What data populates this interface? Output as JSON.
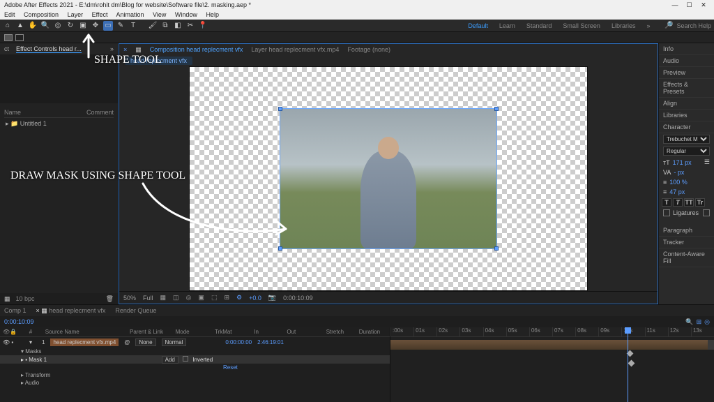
{
  "title": "Adobe After Effects 2021 - E:\\dm\\rohit dm\\Blog for website\\Software file\\2. masking.aep *",
  "menu": [
    "Edit",
    "Composition",
    "Layer",
    "Effect",
    "Animation",
    "View",
    "Window",
    "Help"
  ],
  "workspaces": {
    "active": "Default",
    "items": [
      "Default",
      "Learn",
      "Standard",
      "Small Screen",
      "Libraries"
    ]
  },
  "search_placeholder": "Search Help",
  "subbar": {
    "tool": "",
    "ec_label": "Effect Controls head r..."
  },
  "project": {
    "tabs": [
      "ct",
      "Effect Controls head r..."
    ],
    "cols": [
      "Name",
      "Comment"
    ],
    "items": [
      "Untitled 1"
    ]
  },
  "comp": {
    "tabs": [
      {
        "label": "Composition head replecment vfx",
        "active": true
      },
      {
        "label": "Layer head replecment vfx.mp4",
        "active": false
      },
      {
        "label": "Footage (none)",
        "active": false
      }
    ],
    "chip": "head replecment vfx"
  },
  "viewer_footer": {
    "zoom": "50%",
    "res": "Full",
    "fx": "+0.0",
    "cam": "",
    "time": "0:00:10:09"
  },
  "right_panels": [
    "Info",
    "Audio",
    "Preview",
    "Effects & Presets",
    "Align",
    "Libraries"
  ],
  "character": {
    "label": "Character",
    "font": "Trebuchet MS",
    "style": "Regular",
    "size": "171 px",
    "leading": "",
    "kerning": "- px",
    "tracking": "",
    "vscale": "100 %",
    "hscale": "47 px",
    "buttons": [
      "T",
      "T",
      "TT",
      "Tr"
    ],
    "ligatures": "Ligatures"
  },
  "right_lower": [
    "Paragraph",
    "Tracker",
    "Content-Aware Fill"
  ],
  "timeline": {
    "tabs": [
      "Comp 1",
      "head replecment vfx",
      "Render Queue"
    ],
    "active": "head replecment vfx",
    "timecode": "0:00:10:09",
    "cols": [
      "",
      "#",
      "Source Name",
      "Parent & Link",
      "Mode",
      "TrkMat",
      "",
      "In",
      "Out",
      "Stretch",
      "Duration"
    ],
    "layer": {
      "num": "1",
      "name": "head replecment vfx.mp4",
      "parent": "None",
      "mode": "Normal",
      "in": "0:00:00:00",
      "out": "2:46:19:01",
      "stretch": "",
      "dur": ""
    },
    "sub": [
      "Masks",
      "Mask 1",
      "Transform",
      "Audio"
    ],
    "mask": {
      "mode": "Add",
      "inverted": "Inverted",
      "reset": "Reset"
    },
    "ruler": [
      ":00s",
      "01s",
      "02s",
      "03s",
      "04s",
      "05s",
      "06s",
      "07s",
      "08s",
      "09s",
      "10s",
      "11s",
      "12s",
      "13s"
    ]
  },
  "callouts": {
    "c1": "SHAPE TOOL",
    "c2": "DRAW MASK USING SHAPE TOOL"
  },
  "footer_left": {
    "rate": "10 bpc",
    "btn": "▦"
  }
}
